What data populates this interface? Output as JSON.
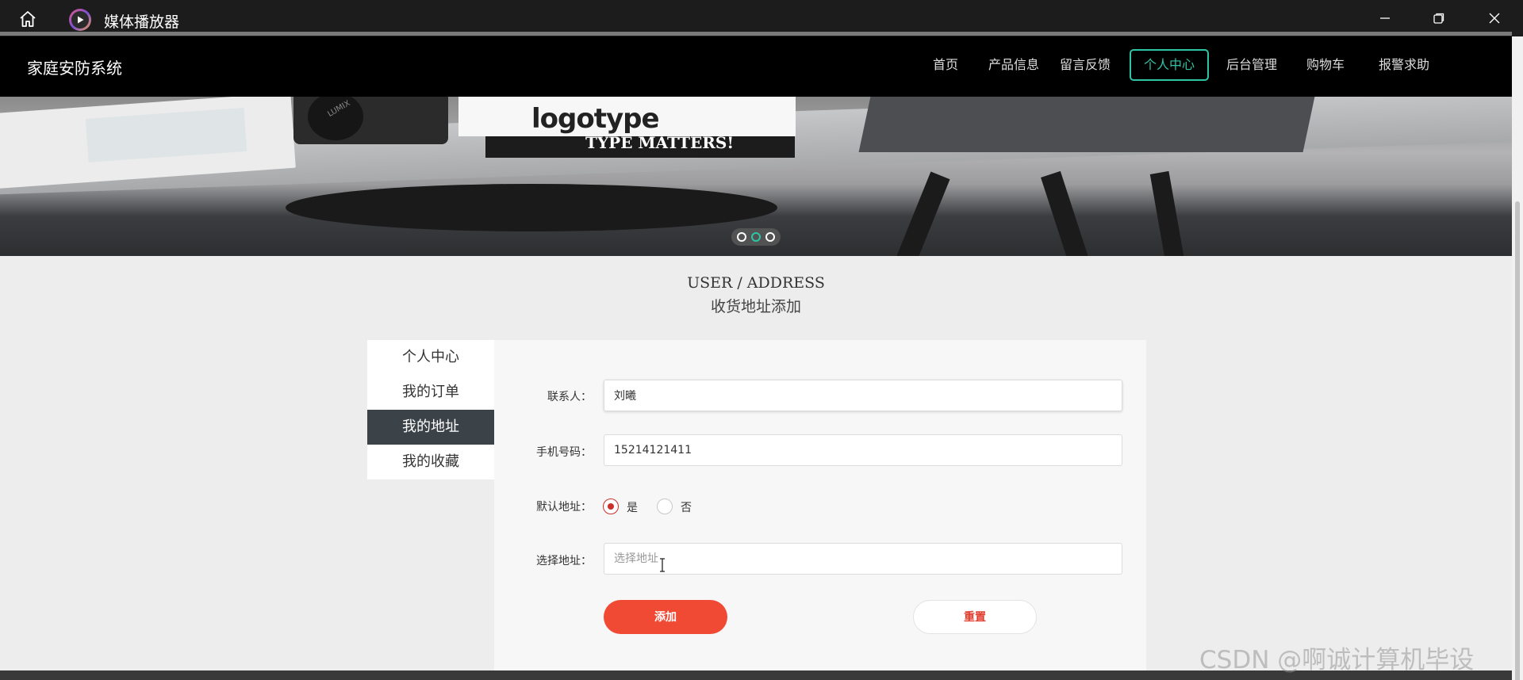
{
  "window": {
    "title": "媒体播放器"
  },
  "site": {
    "logo": "家庭安防系统",
    "nav": [
      {
        "label": "首页"
      },
      {
        "label": "产品信息"
      },
      {
        "label": "留言反馈"
      },
      {
        "label": "个人中心",
        "active": true
      },
      {
        "label": "后台管理"
      },
      {
        "label": "购物车"
      },
      {
        "label": "报警求助"
      }
    ]
  },
  "banner": {
    "book_title": "logotype",
    "book_subtitle": "TYPE MATTERS!",
    "camera_brand": "LUMIX",
    "active_slide": 2,
    "slide_count": 3
  },
  "section": {
    "title_en": "USER / ADDRESS",
    "title_cn": "收货地址添加"
  },
  "side_menu": [
    {
      "label": "个人中心"
    },
    {
      "label": "我的订单"
    },
    {
      "label": "我的地址",
      "active": true
    },
    {
      "label": "我的收藏"
    }
  ],
  "form": {
    "contact_label": "联系人：",
    "contact_value": "刘曦",
    "phone_label": "手机号码：",
    "phone_value": "15214121411",
    "default_label": "默认地址：",
    "default_yes": "是",
    "default_no": "否",
    "default_selected": "是",
    "address_label": "选择地址：",
    "address_placeholder": "选择地址",
    "add_button": "添加",
    "reset_button": "重置"
  },
  "watermark": "CSDN @啊诚计算机毕设",
  "colors": {
    "accent": "#2ec4a6",
    "primary_button": "#f04a35",
    "active_menu": "#3b4349",
    "radio_checked": "#c9302c"
  }
}
